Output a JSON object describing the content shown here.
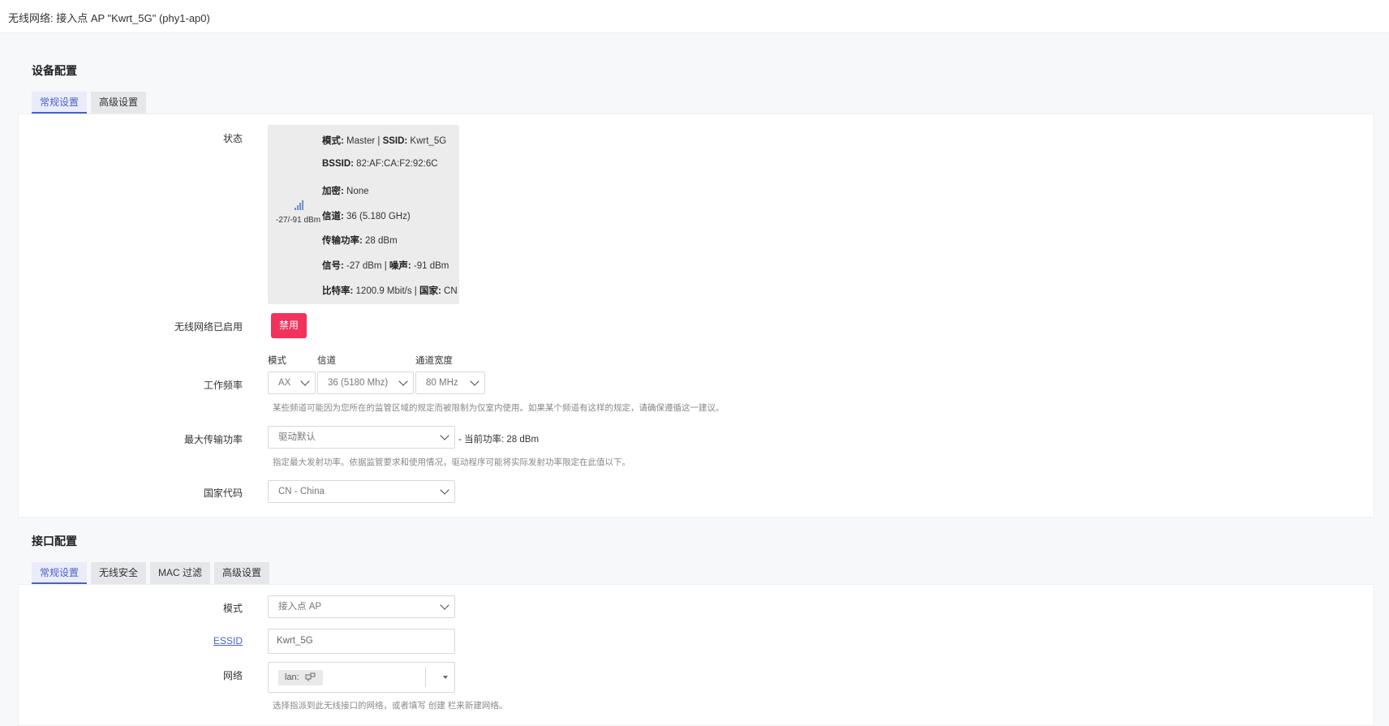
{
  "header": {
    "title": "无线网络: 接入点 AP \"Kwrt_5G\" (phy1-ap0)"
  },
  "device": {
    "section_title": "设备配置",
    "tabs": [
      {
        "label": "常规设置",
        "active": true
      },
      {
        "label": "高级设置",
        "active": false
      }
    ],
    "status": {
      "label": "状态",
      "signal_text": "-27/-91 dBm",
      "lines": [
        [
          {
            "b": "模式:"
          },
          {
            "t": " Master | "
          },
          {
            "b": "SSID:"
          },
          {
            "t": " Kwrt_5G"
          }
        ],
        [
          {
            "b": "BSSID:"
          },
          {
            "t": " 82:AF:CA:F2:92:6C"
          }
        ],
        [
          {
            "b": "加密:"
          },
          {
            "t": " None"
          }
        ],
        [
          {
            "b": "信道:"
          },
          {
            "t": " 36 (5.180 GHz)"
          }
        ],
        [
          {
            "b": "传输功率:"
          },
          {
            "t": " 28 dBm"
          }
        ],
        [
          {
            "b": "信号:"
          },
          {
            "t": " -27 dBm | "
          },
          {
            "b": "噪声:"
          },
          {
            "t": " -91 dBm"
          }
        ],
        [
          {
            "b": "比特率:"
          },
          {
            "t": " 1200.9 Mbit/s | "
          },
          {
            "b": "国家:"
          },
          {
            "t": " CN"
          }
        ]
      ]
    },
    "wireless_enabled": {
      "label": "无线网络已启用",
      "button": "禁用",
      "button_color": "#f0325c"
    },
    "frequency": {
      "label": "工作频率",
      "mode_label": "模式",
      "channel_label": "信道",
      "width_label": "通道宽度",
      "mode_value": "AX",
      "channel_value": "36 (5180 Mhz)",
      "width_value": "80 MHz",
      "hint": "某些频道可能因为您所在的监管区域的规定而被限制为仅室内使用。如果某个频道有这样的规定，请确保遵循这一建议。"
    },
    "max_power": {
      "label": "最大传输功率",
      "value": "驱动默认",
      "current": "- 当前功率: 28 dBm",
      "hint": "指定最大发射功率。依据监管要求和使用情况，驱动程序可能将实际发射功率限定在此值以下。"
    },
    "country": {
      "label": "国家代码",
      "value": "CN - China"
    }
  },
  "interface": {
    "section_title": "接口配置",
    "tabs": [
      {
        "label": "常规设置",
        "active": true
      },
      {
        "label": "无线安全",
        "active": false
      },
      {
        "label": "MAC 过滤",
        "active": false
      },
      {
        "label": "高级设置",
        "active": false
      }
    ],
    "mode": {
      "label": "模式",
      "value": "接入点 AP"
    },
    "essid": {
      "label": "ESSID",
      "value": "Kwrt_5G"
    },
    "network": {
      "label": "网络",
      "chip": "lan:",
      "hint": "选择指派到此无线接口的网络，或者填写 创建 栏来新建网络。"
    }
  },
  "colors": {
    "accent": "#4b61c7",
    "danger": "#f0325c"
  }
}
